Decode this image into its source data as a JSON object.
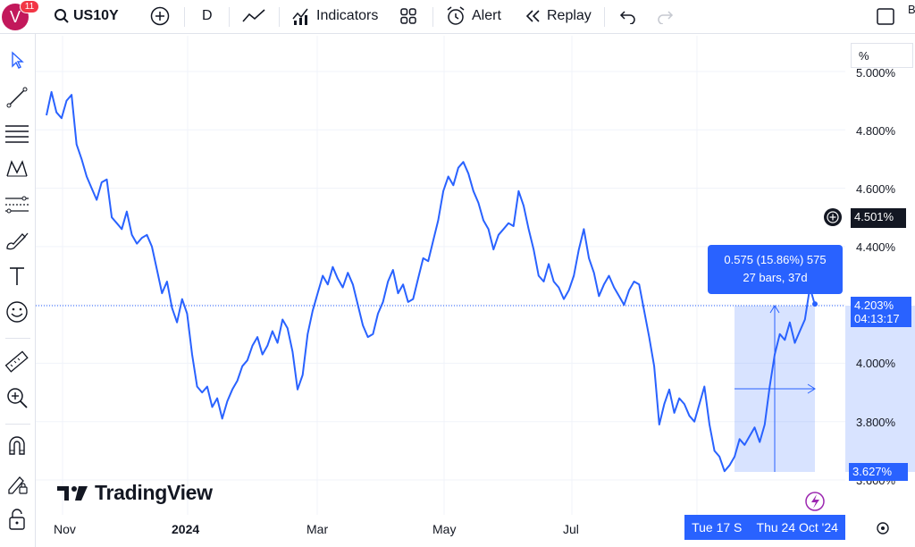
{
  "topbar": {
    "badge_count": "11",
    "avatar_letter": "V",
    "symbol": "US10Y",
    "interval": "D",
    "indicators_label": "Indicators",
    "alert_label": "Alert",
    "replay_label": "Replay",
    "edge_letter": "B"
  },
  "sidebar": {
    "tools": [
      "cursor-icon",
      "trend-line-icon",
      "horizontal-lines-icon",
      "pattern-icon",
      "fib-icon",
      "brush-icon",
      "text-icon",
      "emoji-icon",
      "ruler-icon",
      "zoom-in-icon",
      "magnet-icon",
      "lock-pencil-icon",
      "lock-icon"
    ]
  },
  "price_axis": {
    "scale_label": "%",
    "ticks": [
      "5.000%",
      "4.800%",
      "4.600%",
      "4.400%",
      "4.000%",
      "3.800%",
      "3.600%"
    ],
    "crosshair_price": "4.501%",
    "last_price": "4.203%",
    "countdown": "04:13:17",
    "measure_low": "3.627%"
  },
  "time_axis": {
    "ticks": [
      "Nov",
      "2024",
      "Mar",
      "May",
      "Jul"
    ],
    "tag_left": "Tue 17 S",
    "tag_right": "Thu 24 Oct '24"
  },
  "measure": {
    "line1": "0.575 (15.86%) 575",
    "line2": "27 bars, 37d"
  },
  "brand": {
    "logo_text": "TradingView"
  },
  "chart_data": {
    "type": "line",
    "title": "US10Y",
    "ylabel": "%",
    "ylim": [
      3.6,
      5.0
    ],
    "line_color": "#2962ff",
    "last_value": 4.203,
    "x_labels": [
      "Nov",
      "2024",
      "Mar",
      "May",
      "Jul"
    ],
    "values": [
      4.85,
      4.93,
      4.86,
      4.84,
      4.9,
      4.92,
      4.75,
      4.7,
      4.64,
      4.6,
      4.56,
      4.62,
      4.63,
      4.5,
      4.48,
      4.46,
      4.52,
      4.44,
      4.41,
      4.43,
      4.44,
      4.4,
      4.32,
      4.24,
      4.28,
      4.19,
      4.14,
      4.22,
      4.17,
      4.03,
      3.92,
      3.9,
      3.92,
      3.85,
      3.88,
      3.81,
      3.87,
      3.91,
      3.94,
      3.99,
      4.01,
      4.06,
      4.09,
      4.03,
      4.06,
      4.11,
      4.07,
      4.15,
      4.12,
      4.04,
      3.91,
      3.96,
      4.1,
      4.18,
      4.24,
      4.3,
      4.27,
      4.33,
      4.29,
      4.26,
      4.31,
      4.27,
      4.2,
      4.13,
      4.09,
      4.1,
      4.17,
      4.21,
      4.28,
      4.32,
      4.24,
      4.27,
      4.21,
      4.22,
      4.29,
      4.36,
      4.35,
      4.42,
      4.49,
      4.59,
      4.64,
      4.61,
      4.67,
      4.69,
      4.65,
      4.59,
      4.55,
      4.49,
      4.46,
      4.39,
      4.44,
      4.46,
      4.48,
      4.47,
      4.59,
      4.54,
      4.46,
      4.39,
      4.3,
      4.28,
      4.34,
      4.28,
      4.26,
      4.22,
      4.25,
      4.3,
      4.39,
      4.46,
      4.36,
      4.31,
      4.23,
      4.27,
      4.3,
      4.26,
      4.23,
      4.2,
      4.25,
      4.28,
      4.27,
      4.18,
      4.09,
      3.99,
      3.79,
      3.86,
      3.91,
      3.83,
      3.88,
      3.86,
      3.82,
      3.8,
      3.86,
      3.92,
      3.79,
      3.7,
      3.68,
      3.63,
      3.65,
      3.68,
      3.74,
      3.72,
      3.75,
      3.78,
      3.73,
      3.79,
      3.92,
      4.03,
      4.1,
      4.08,
      4.14,
      4.07,
      4.11,
      4.15,
      4.26,
      4.2
    ]
  }
}
